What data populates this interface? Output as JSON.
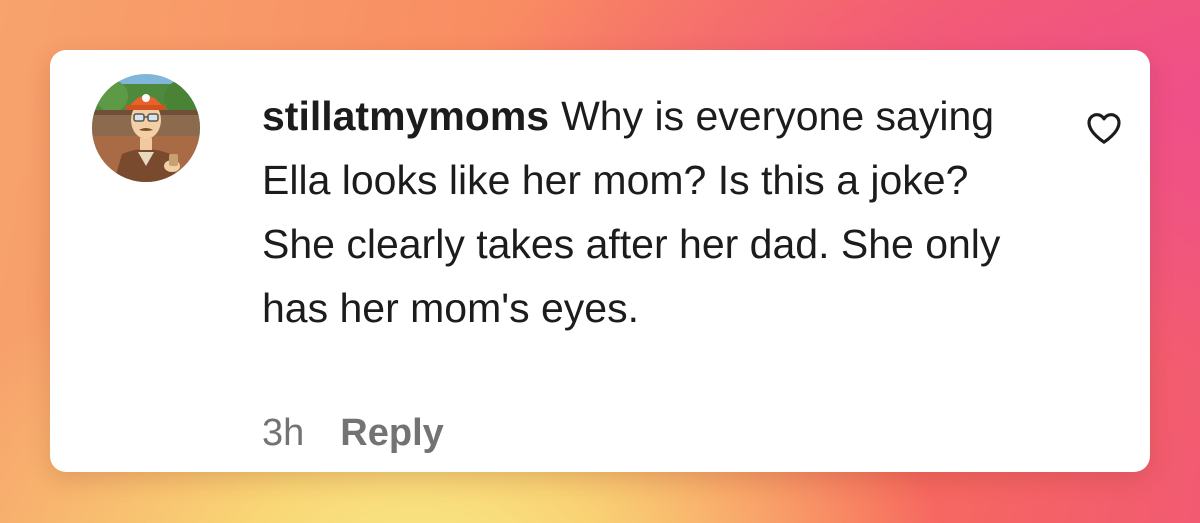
{
  "comment": {
    "username": "stillatmymoms",
    "text": "Why is everyone saying Ella looks like her mom? Is this a joke? She clearly takes after her dad. She only has her mom's eyes.",
    "timestamp": "3h",
    "reply_label": "Reply",
    "avatar_icon": "cartoon-character-avatar",
    "like_icon": "heart-outline-icon"
  },
  "colors": {
    "text": "#1c1c1c",
    "meta": "#737373",
    "card": "#ffffff"
  }
}
